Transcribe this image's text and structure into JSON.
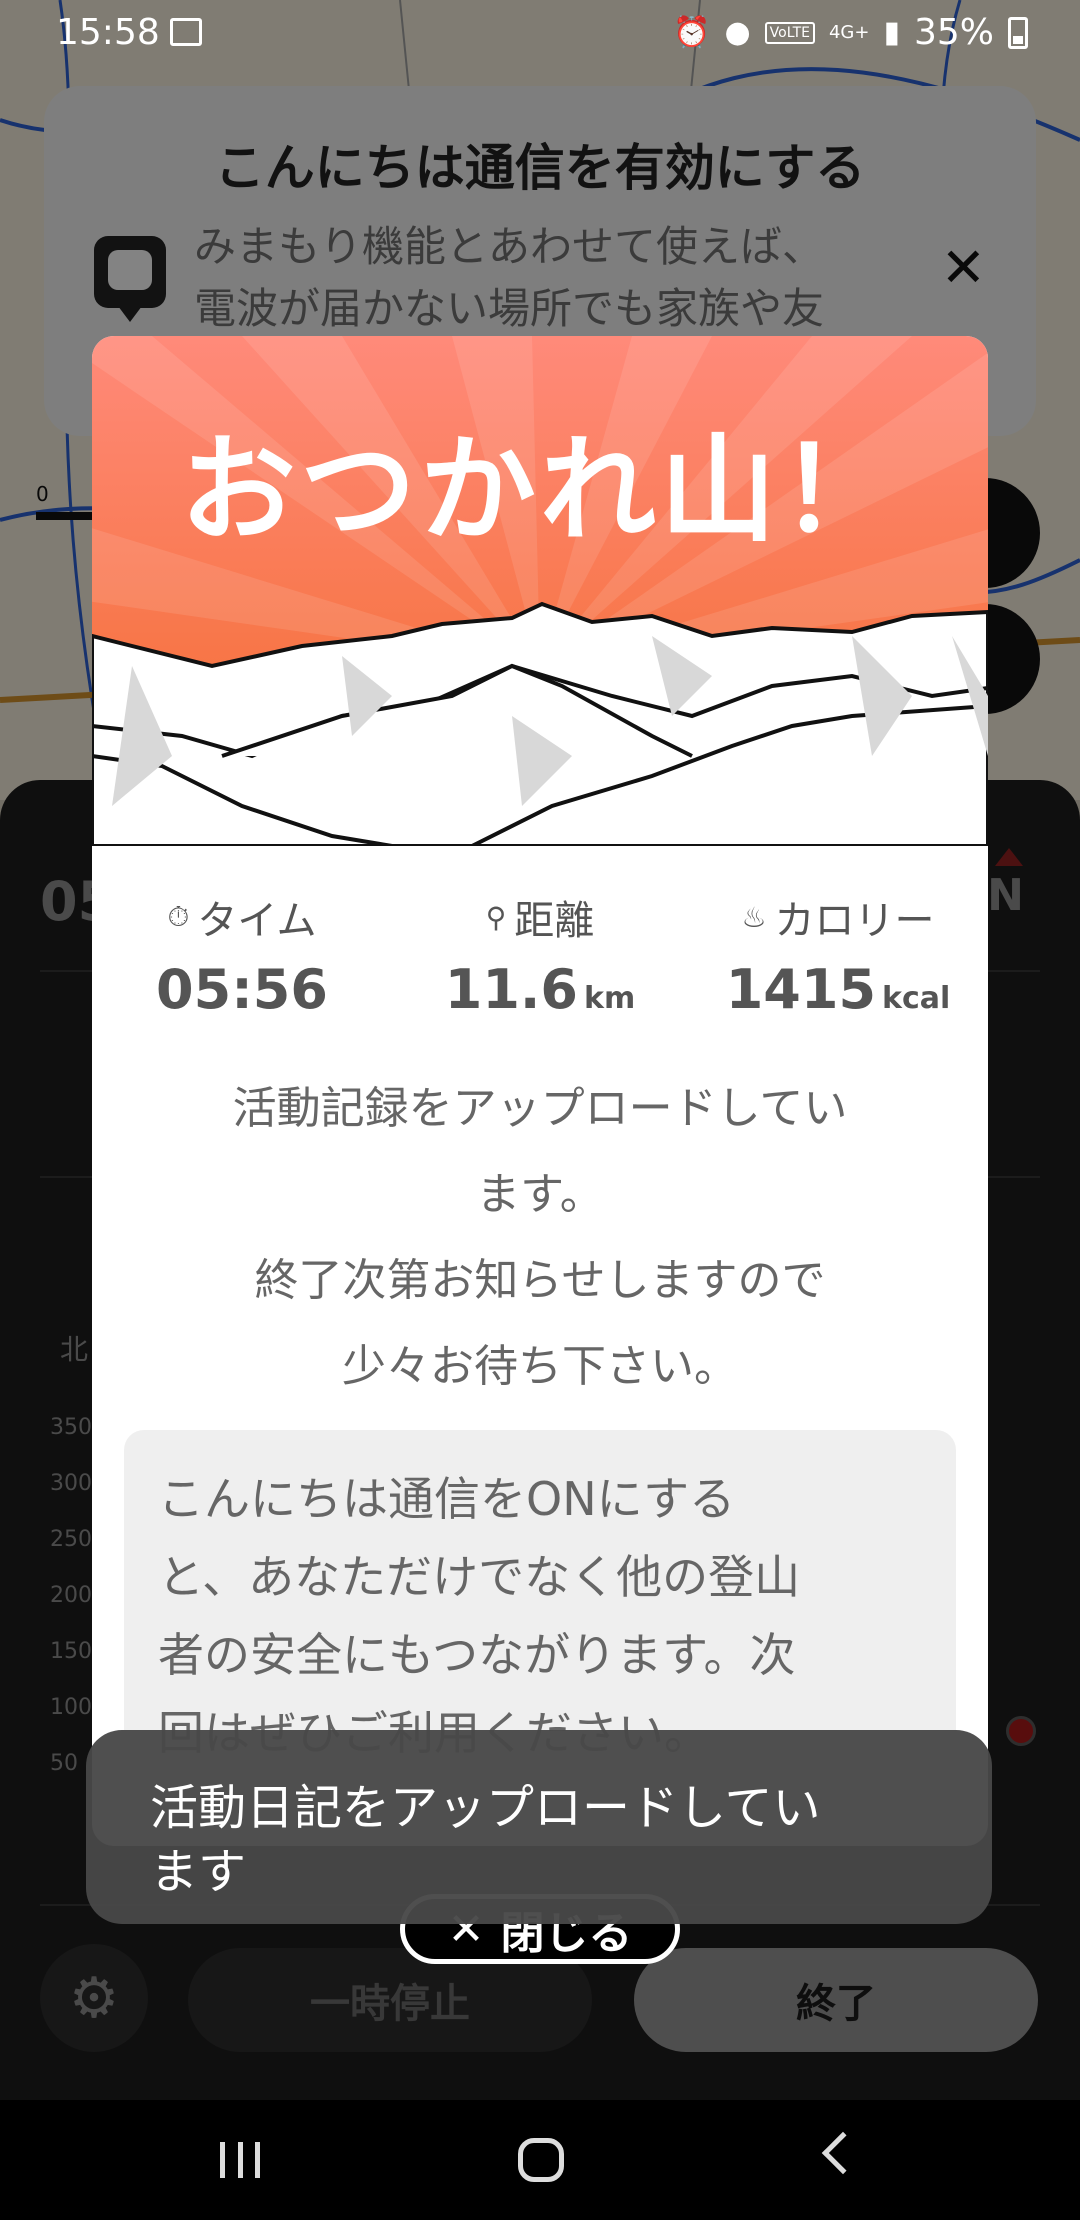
{
  "status_bar": {
    "time": "15:58",
    "battery": "35%",
    "network": "4G+",
    "volte": "VoLTE"
  },
  "banner": {
    "title": "こんにちは通信を有効にする",
    "body": "みまもり機能とあわせて使えば、\n電波が届かない場所でも家族や友"
  },
  "background": {
    "time_peek": "05",
    "compass": "N",
    "north_label": "北",
    "scale_zero": "0",
    "y_ticks": [
      "350",
      "300",
      "250",
      "200",
      "150",
      "100",
      "50"
    ],
    "pause_label": "一時停止",
    "end_label": "終了"
  },
  "modal": {
    "title": "おつかれ山！",
    "stats": {
      "time": {
        "label": "タイム",
        "value": "05:56"
      },
      "distance": {
        "label": "距離",
        "value": "11.6",
        "unit": "km"
      },
      "calories": {
        "label": "カロリー",
        "value": "1415",
        "unit": "kcal"
      }
    },
    "message": "活動記録をアップロードしてい\nます。\n終了次第お知らせしますので\n少々お待ち下さい。",
    "info": "こんにちは通信をONにする\nと、あなただけでなく他の登山\n者の安全にもつながります。次\n回はぜひご利用ください。",
    "close_label": "閉じる"
  },
  "toast": {
    "text": "活動日記をアップロードしてい\nます"
  },
  "colors": {
    "hero_top": "#ff8a7a",
    "hero_bottom": "#f36a2a",
    "accent_red": "#a01818"
  }
}
